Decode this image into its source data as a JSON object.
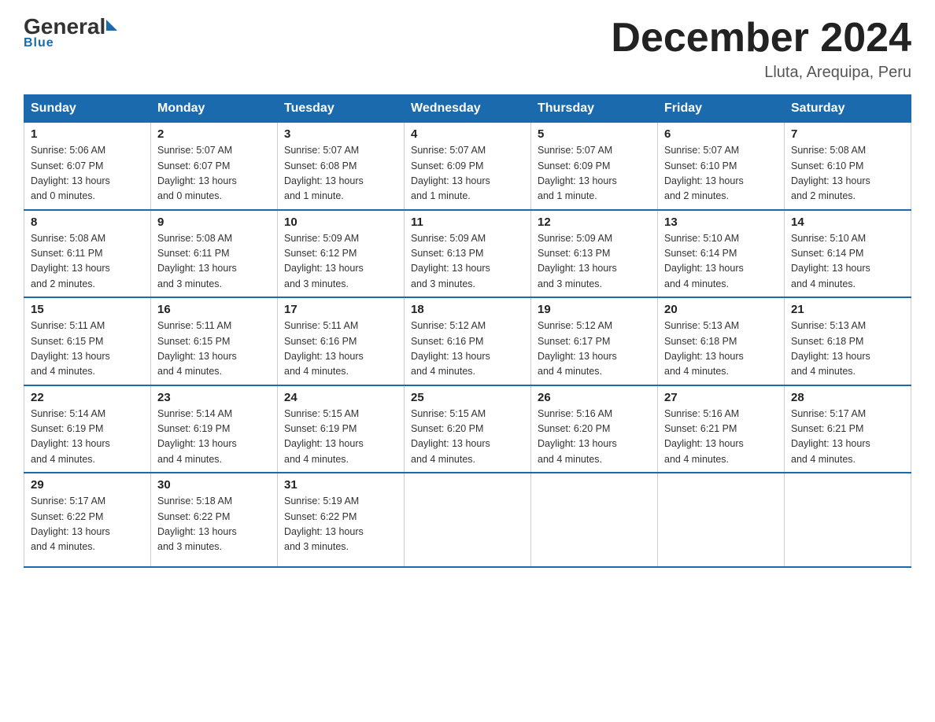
{
  "logo": {
    "general": "General",
    "blue": "Blue"
  },
  "title": "December 2024",
  "location": "Lluta, Arequipa, Peru",
  "days_header": [
    "Sunday",
    "Monday",
    "Tuesday",
    "Wednesday",
    "Thursday",
    "Friday",
    "Saturday"
  ],
  "weeks": [
    [
      {
        "day": "1",
        "info": "Sunrise: 5:06 AM\nSunset: 6:07 PM\nDaylight: 13 hours\nand 0 minutes."
      },
      {
        "day": "2",
        "info": "Sunrise: 5:07 AM\nSunset: 6:07 PM\nDaylight: 13 hours\nand 0 minutes."
      },
      {
        "day": "3",
        "info": "Sunrise: 5:07 AM\nSunset: 6:08 PM\nDaylight: 13 hours\nand 1 minute."
      },
      {
        "day": "4",
        "info": "Sunrise: 5:07 AM\nSunset: 6:09 PM\nDaylight: 13 hours\nand 1 minute."
      },
      {
        "day": "5",
        "info": "Sunrise: 5:07 AM\nSunset: 6:09 PM\nDaylight: 13 hours\nand 1 minute."
      },
      {
        "day": "6",
        "info": "Sunrise: 5:07 AM\nSunset: 6:10 PM\nDaylight: 13 hours\nand 2 minutes."
      },
      {
        "day": "7",
        "info": "Sunrise: 5:08 AM\nSunset: 6:10 PM\nDaylight: 13 hours\nand 2 minutes."
      }
    ],
    [
      {
        "day": "8",
        "info": "Sunrise: 5:08 AM\nSunset: 6:11 PM\nDaylight: 13 hours\nand 2 minutes."
      },
      {
        "day": "9",
        "info": "Sunrise: 5:08 AM\nSunset: 6:11 PM\nDaylight: 13 hours\nand 3 minutes."
      },
      {
        "day": "10",
        "info": "Sunrise: 5:09 AM\nSunset: 6:12 PM\nDaylight: 13 hours\nand 3 minutes."
      },
      {
        "day": "11",
        "info": "Sunrise: 5:09 AM\nSunset: 6:13 PM\nDaylight: 13 hours\nand 3 minutes."
      },
      {
        "day": "12",
        "info": "Sunrise: 5:09 AM\nSunset: 6:13 PM\nDaylight: 13 hours\nand 3 minutes."
      },
      {
        "day": "13",
        "info": "Sunrise: 5:10 AM\nSunset: 6:14 PM\nDaylight: 13 hours\nand 4 minutes."
      },
      {
        "day": "14",
        "info": "Sunrise: 5:10 AM\nSunset: 6:14 PM\nDaylight: 13 hours\nand 4 minutes."
      }
    ],
    [
      {
        "day": "15",
        "info": "Sunrise: 5:11 AM\nSunset: 6:15 PM\nDaylight: 13 hours\nand 4 minutes."
      },
      {
        "day": "16",
        "info": "Sunrise: 5:11 AM\nSunset: 6:15 PM\nDaylight: 13 hours\nand 4 minutes."
      },
      {
        "day": "17",
        "info": "Sunrise: 5:11 AM\nSunset: 6:16 PM\nDaylight: 13 hours\nand 4 minutes."
      },
      {
        "day": "18",
        "info": "Sunrise: 5:12 AM\nSunset: 6:16 PM\nDaylight: 13 hours\nand 4 minutes."
      },
      {
        "day": "19",
        "info": "Sunrise: 5:12 AM\nSunset: 6:17 PM\nDaylight: 13 hours\nand 4 minutes."
      },
      {
        "day": "20",
        "info": "Sunrise: 5:13 AM\nSunset: 6:18 PM\nDaylight: 13 hours\nand 4 minutes."
      },
      {
        "day": "21",
        "info": "Sunrise: 5:13 AM\nSunset: 6:18 PM\nDaylight: 13 hours\nand 4 minutes."
      }
    ],
    [
      {
        "day": "22",
        "info": "Sunrise: 5:14 AM\nSunset: 6:19 PM\nDaylight: 13 hours\nand 4 minutes."
      },
      {
        "day": "23",
        "info": "Sunrise: 5:14 AM\nSunset: 6:19 PM\nDaylight: 13 hours\nand 4 minutes."
      },
      {
        "day": "24",
        "info": "Sunrise: 5:15 AM\nSunset: 6:19 PM\nDaylight: 13 hours\nand 4 minutes."
      },
      {
        "day": "25",
        "info": "Sunrise: 5:15 AM\nSunset: 6:20 PM\nDaylight: 13 hours\nand 4 minutes."
      },
      {
        "day": "26",
        "info": "Sunrise: 5:16 AM\nSunset: 6:20 PM\nDaylight: 13 hours\nand 4 minutes."
      },
      {
        "day": "27",
        "info": "Sunrise: 5:16 AM\nSunset: 6:21 PM\nDaylight: 13 hours\nand 4 minutes."
      },
      {
        "day": "28",
        "info": "Sunrise: 5:17 AM\nSunset: 6:21 PM\nDaylight: 13 hours\nand 4 minutes."
      }
    ],
    [
      {
        "day": "29",
        "info": "Sunrise: 5:17 AM\nSunset: 6:22 PM\nDaylight: 13 hours\nand 4 minutes."
      },
      {
        "day": "30",
        "info": "Sunrise: 5:18 AM\nSunset: 6:22 PM\nDaylight: 13 hours\nand 3 minutes."
      },
      {
        "day": "31",
        "info": "Sunrise: 5:19 AM\nSunset: 6:22 PM\nDaylight: 13 hours\nand 3 minutes."
      },
      {
        "day": "",
        "info": ""
      },
      {
        "day": "",
        "info": ""
      },
      {
        "day": "",
        "info": ""
      },
      {
        "day": "",
        "info": ""
      }
    ]
  ]
}
